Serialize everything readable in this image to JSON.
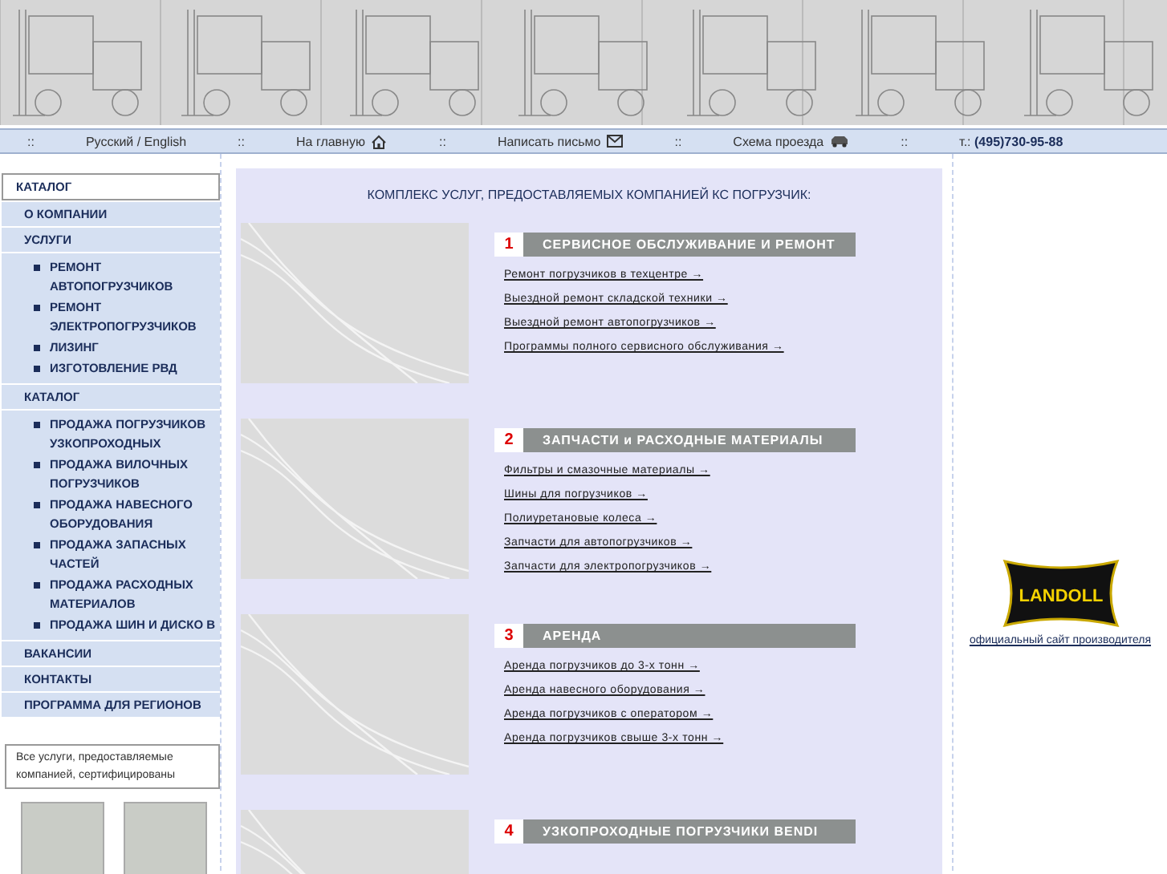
{
  "nav": {
    "items": [
      {
        "kind": "sep",
        "text": "::"
      },
      {
        "kind": "link",
        "text": "Русский / English"
      },
      {
        "kind": "sep",
        "text": "::"
      },
      {
        "kind": "home",
        "text": "На главную"
      },
      {
        "kind": "sep",
        "text": "::"
      },
      {
        "kind": "mail",
        "text": "Написать письмо"
      },
      {
        "kind": "sep",
        "text": "::"
      },
      {
        "kind": "car",
        "text": "Схема проезда"
      },
      {
        "kind": "sep",
        "text": "::"
      },
      {
        "kind": "phone",
        "text": "т.: **(495)730-95-88**"
      }
    ]
  },
  "sidebar": {
    "items": [
      {
        "label": "КАТАЛОГ",
        "selected": true
      },
      {
        "label": "О КОМПАНИИ",
        "selected": false
      },
      {
        "label": "УСЛУГИ",
        "selected": false,
        "children": [
          "РЕМОНТ АВТОПОГРУЗЧИКОВ",
          "РЕМОНТ ЭЛЕКТРОПОГРУЗЧИКОВ",
          "ЛИЗИНГ",
          "ИЗГОТОВЛЕНИЕ РВД"
        ]
      },
      {
        "label": "КАТАЛОГ",
        "selected": false,
        "children": [
          "ПРОДАЖА ПОГРУЗЧИКОВ УЗКОПРОХОДНЫХ",
          "ПРОДАЖА ВИЛОЧНЫХ ПОГРУЗЧИКОВ",
          "ПРОДАЖА НАВЕСНОГО ОБОРУДОВАНИЯ",
          "ПРОДАЖА ЗАПАСНЫХ ЧАСТЕЙ",
          "ПРОДАЖА РАСХОДНЫХ МАТЕРИАЛОВ",
          "ПРОДАЖА ШИН И ДИСКО В"
        ]
      },
      {
        "label": "ВАКАНСИИ",
        "selected": false
      },
      {
        "label": "КОНТАКТЫ",
        "selected": false
      },
      {
        "label": "ПРОГРАММА ДЛЯ РЕГИОНОВ",
        "selected": false
      }
    ],
    "certificates_note": "Все услуги, предоставляемые компанией, сертифицированы"
  },
  "main": {
    "title": "КОМПЛЕКС УСЛУГ, ПРЕДОСТАВЛЯЕМЫХ КОМПАНИЕЙ КС ПОГРУЗЧИК:",
    "sections": [
      {
        "number": "1",
        "title": "СЕРВИСНОЕ ОБСЛУЖИВАНИЕ И РЕМОНТ",
        "links": [
          "Ремонт погрузчиков в техцентре →",
          "Выездной ремонт складской техники →",
          "Выездной ремонт автопогрузчиков →",
          "Программы полного сервисного обслуживания →"
        ]
      },
      {
        "number": "2",
        "title": "ЗАПЧАСТИ и РАСХОДНЫЕ МАТЕРИАЛЫ",
        "links": [
          "Фильтры и смазочные материалы →",
          "Шины для погрузчиков →",
          "Полиуретановые колеса →",
          "Запчасти для автопогрузчиков →",
          "Запчасти для электропогрузчиков →"
        ]
      },
      {
        "number": "3",
        "title": "АРЕНДА",
        "links": [
          "Аренда погрузчиков до 3-х тонн →",
          "Аренда навесного оборудования →",
          "Аренда погрузчиков с оператором →",
          "Аренда погрузчиков свыше 3-х тонн →"
        ]
      },
      {
        "number": "4",
        "title": "УЗКОПРОХОДНЫЕ ПОГРУЗЧИКИ BENDI"
      }
    ]
  },
  "aside": {
    "logo_text": "LANDOLL",
    "link": "официальный сайт производителя"
  }
}
